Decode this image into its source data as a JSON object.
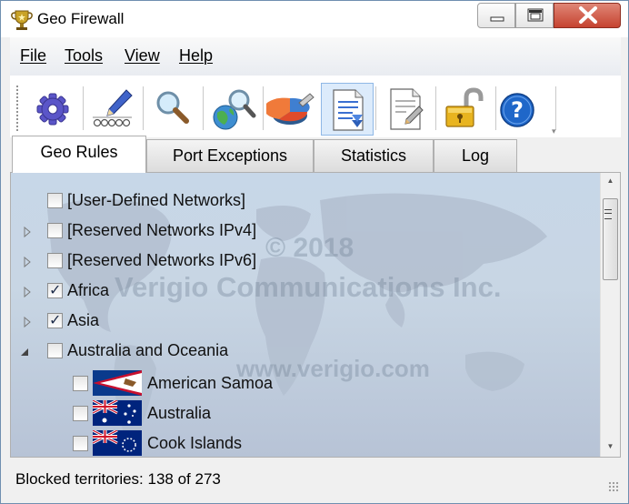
{
  "window": {
    "title": "Geo Firewall"
  },
  "menu": [
    "File",
    "Tools",
    "View",
    "Help"
  ],
  "toolbar": {
    "buttons": [
      {
        "icon": "gear-icon",
        "active": false
      },
      {
        "icon": "edit-rules-icon",
        "active": false
      },
      {
        "icon": "search-icon",
        "active": false
      },
      {
        "icon": "globe-search-icon",
        "active": false
      },
      {
        "icon": "pie-chart-icon",
        "active": false
      },
      {
        "icon": "log-document-icon",
        "active": true
      },
      {
        "icon": "edit-document-icon",
        "active": false
      },
      {
        "icon": "unlock-icon",
        "active": false
      },
      {
        "icon": "help-icon",
        "active": false
      }
    ]
  },
  "tabs": [
    "Geo Rules",
    "Port Exceptions",
    "Statistics",
    "Log"
  ],
  "active_tab": "Geo Rules",
  "watermark": {
    "line1": "© 2018",
    "line2": "Verigio Communications Inc.",
    "line3": "www.verigio.com"
  },
  "tree": [
    {
      "label": "[User-Defined Networks]",
      "checked": false,
      "expander": "none",
      "level": 0
    },
    {
      "label": "[Reserved Networks IPv4]",
      "checked": false,
      "expander": "collapsed",
      "level": 0
    },
    {
      "label": "[Reserved Networks IPv6]",
      "checked": false,
      "expander": "collapsed",
      "level": 0
    },
    {
      "label": "Africa",
      "checked": true,
      "expander": "collapsed",
      "level": 0
    },
    {
      "label": "Asia",
      "checked": true,
      "expander": "collapsed",
      "level": 0
    },
    {
      "label": "Australia and Oceania",
      "checked": false,
      "expander": "expanded",
      "level": 0
    },
    {
      "label": "American Samoa",
      "checked": false,
      "expander": "none",
      "level": 1,
      "flag": "american-samoa-flag-icon"
    },
    {
      "label": "Australia",
      "checked": false,
      "expander": "none",
      "level": 1,
      "flag": "australia-flag-icon"
    },
    {
      "label": "Cook Islands",
      "checked": false,
      "expander": "none",
      "level": 1,
      "flag": "cook-islands-flag-icon"
    }
  ],
  "status": {
    "text": "Blocked territories: 138 of 273"
  },
  "colors": {
    "tree_background": "#c5d3e3",
    "close_button": "#c9452f",
    "active_toolbar_button": "#dcebfb"
  }
}
